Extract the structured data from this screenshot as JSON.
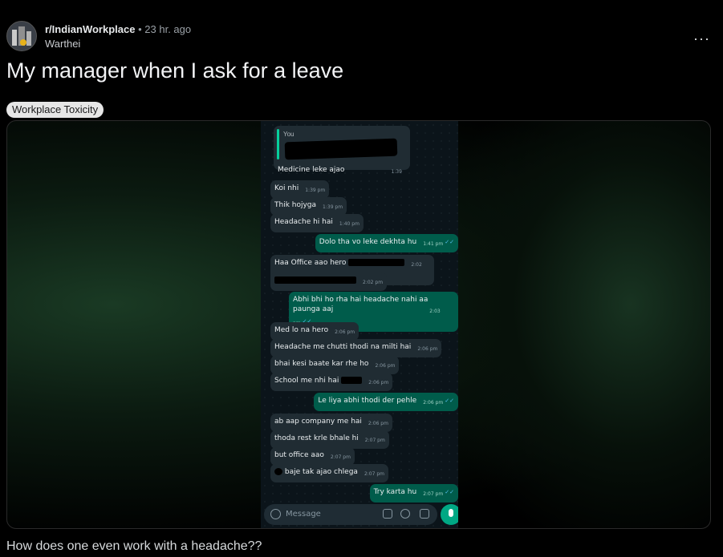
{
  "post": {
    "subreddit": "r/IndianWorkplace",
    "separator": "•",
    "time": "23 hr. ago",
    "author": "Warthei",
    "more_icon": "···",
    "title": "My manager when I ask for a leave",
    "flair": "Workplace Toxicity",
    "body": "How does one even work with a headache??"
  },
  "chat": {
    "quote_label": "You",
    "messages": [
      {
        "dir": "in",
        "text": "Medicine leke ajao",
        "time": "1:39 pm"
      },
      {
        "dir": "in",
        "text": "Koi nhi",
        "time": "1:39 pm"
      },
      {
        "dir": "in",
        "text": "Thik hojyga",
        "time": "1:39 pm"
      },
      {
        "dir": "in",
        "text": "Headache hi hai",
        "time": "1:40 pm"
      },
      {
        "dir": "out",
        "text": "Dolo tha vo leke dekhta hu",
        "time": "1:41 pm"
      },
      {
        "dir": "in",
        "text": "Haa Office aao hero",
        "time": "2:02 pm"
      },
      {
        "dir": "in",
        "text": "",
        "time": "2:02 pm"
      },
      {
        "dir": "out",
        "text": "Abhi bhi ho rha hai headache nahi aa paunga aaj",
        "time": "2:03 pm"
      },
      {
        "dir": "in",
        "text": "Med lo na hero",
        "time": "2:06 pm"
      },
      {
        "dir": "in",
        "text": "Headache me chutti thodi na milti hai",
        "time": "2:06 pm"
      },
      {
        "dir": "in",
        "text": "bhai kesi baate kar rhe ho",
        "time": "2:06 pm"
      },
      {
        "dir": "in",
        "text": "School me nhi hai",
        "time": "2:06 pm"
      },
      {
        "dir": "out",
        "text": "Le liya abhi thodi der pehle",
        "time": "2:06 pm"
      },
      {
        "dir": "in",
        "text": "ab aap company me hai",
        "time": "2:06 pm"
      },
      {
        "dir": "in",
        "text": "thoda rest krle bhale hi",
        "time": "2:07 pm"
      },
      {
        "dir": "in",
        "text": "but office aao",
        "time": "2:07 pm"
      },
      {
        "dir": "in",
        "text": "baje tak ajao chlega",
        "time": "2:07 pm"
      },
      {
        "dir": "out",
        "text": "Try karta hu",
        "time": "2:07 pm"
      }
    ],
    "composer_placeholder": "Message"
  }
}
